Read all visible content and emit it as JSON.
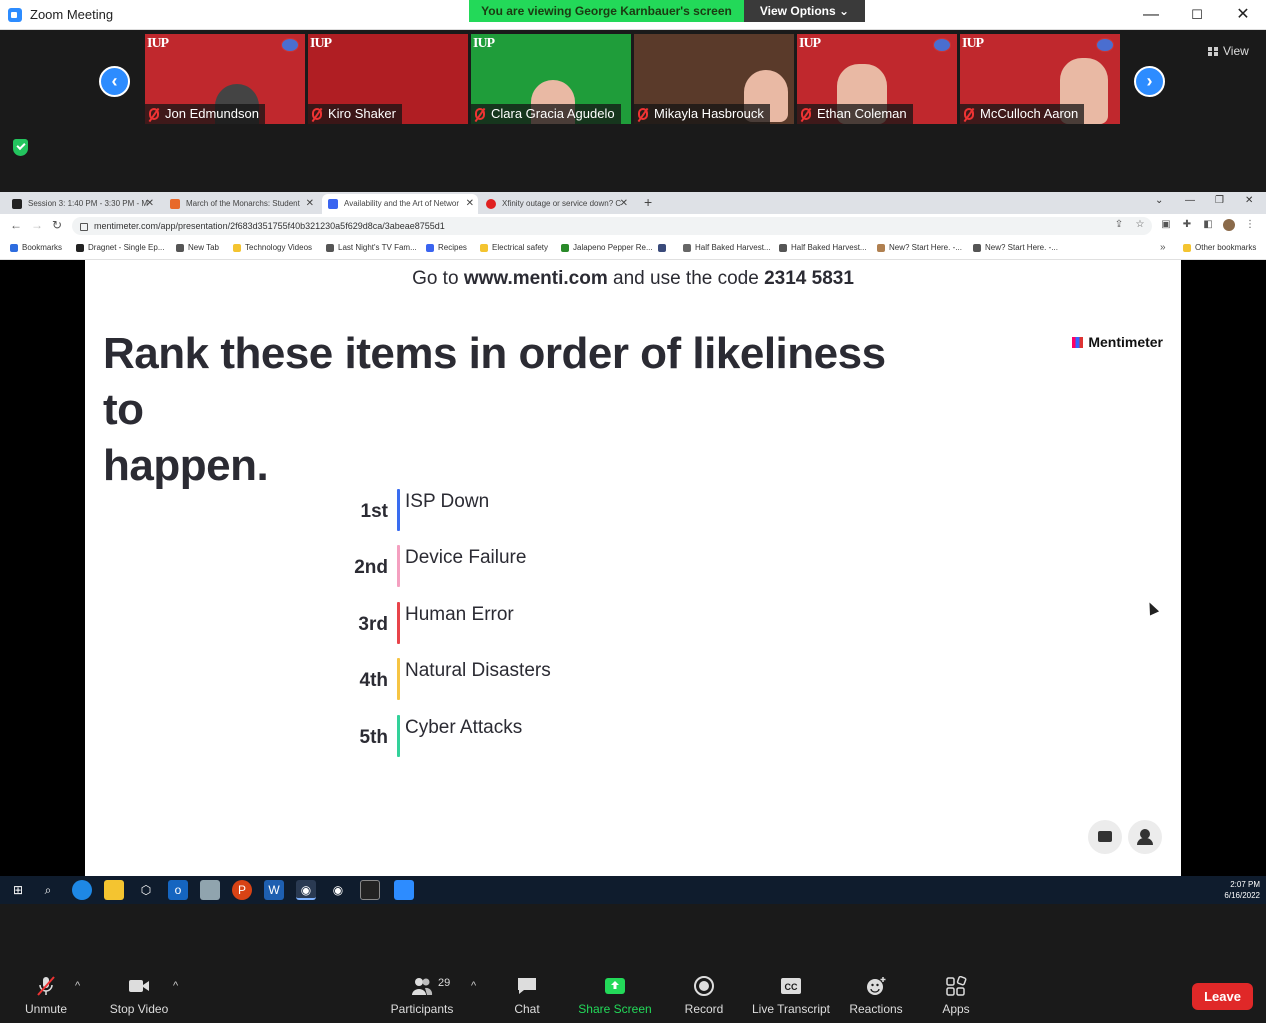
{
  "window": {
    "title": "Zoom Meeting",
    "viewing_banner": "You are viewing George Karnbauer's screen",
    "view_options_label": "View Options",
    "view_options_chevron": "⌄",
    "minimize": "—",
    "maximize": "☐",
    "close": "✕"
  },
  "gallery": {
    "prev_icon": "‹",
    "next_icon": "›",
    "view_label": "View",
    "participants": [
      {
        "name": "Jon Edmundson",
        "bg": "#c0282d"
      },
      {
        "name": "Kiro Shaker",
        "bg": "#b01e23"
      },
      {
        "name": "Clara Gracia Agudelo",
        "bg": "#1f9d3a"
      },
      {
        "name": "Mikayla Hasbrouck",
        "bg": "#5a3a2a"
      },
      {
        "name": "Ethan Coleman",
        "bg": "#c0282d"
      },
      {
        "name": "McCulloch Aaron",
        "bg": "#c0282d"
      }
    ],
    "logo_text": "IUP"
  },
  "browser": {
    "tabs": [
      {
        "title": "Session 3: 1:40 PM - 3:30 PM - M",
        "color": "#222"
      },
      {
        "title": "March of the Monarchs: Student",
        "color": "#e8692a"
      },
      {
        "title": "Availability and the Art of Networ",
        "color": "#3a64f0"
      },
      {
        "title": "Xfinity outage or service down? C",
        "color": "#e02020"
      }
    ],
    "new_tab": "+",
    "tab_controls": {
      "dropdown": "⌄",
      "min": "—",
      "max": "❐",
      "close": "✕"
    },
    "nav": {
      "back": "←",
      "forward": "→",
      "reload": "↻"
    },
    "url": "mentimeter.com/app/presentation/2f683d351755f40b321230a5f629d8ca/3abeae8755d1",
    "bookmarks": [
      {
        "label": "Bookmarks",
        "color": "#2d6cdf"
      },
      {
        "label": "Dragnet - Single Ep...",
        "color": "#222"
      },
      {
        "label": "New Tab",
        "color": "#555"
      },
      {
        "label": "Technology Videos",
        "color": "#f4c430"
      },
      {
        "label": "Last Night's TV Fam...",
        "color": "#555"
      },
      {
        "label": "Recipes",
        "color": "#3a64f0"
      },
      {
        "label": "Electrical safety",
        "color": "#f4c430"
      },
      {
        "label": "Jalapeno Pepper Re...",
        "color": "#2a8a2a"
      },
      {
        "label": "Half Baked Harvest...",
        "color": "#666"
      },
      {
        "label": "Half Baked Harvest...",
        "color": "#555"
      },
      {
        "label": "New? Start Here. -...",
        "color": "#b08050"
      },
      {
        "label": "New? Start Here. -...",
        "color": "#555"
      }
    ],
    "bookmarks_more": "»",
    "other_bookmarks": "Other bookmarks"
  },
  "slide": {
    "join_prefix": "Go to ",
    "join_site": "www.menti.com",
    "join_middle": " and use the code ",
    "join_code": "2314 5831",
    "brand": "Mentimeter",
    "question_line1": "Rank these items in order of likeliness to",
    "question_line2": "happen.",
    "ranking": [
      {
        "pos": "1st",
        "label": "ISP Down",
        "color": "#3a6df0"
      },
      {
        "pos": "2nd",
        "label": "Device Failure",
        "color": "#f4a0c0"
      },
      {
        "pos": "3rd",
        "label": "Human Error",
        "color": "#e8444a"
      },
      {
        "pos": "4th",
        "label": "Natural Disasters",
        "color": "#f6c443"
      },
      {
        "pos": "5th",
        "label": "Cyber Attacks",
        "color": "#33d19a"
      }
    ]
  },
  "taskbar": {
    "time": "2:07 PM",
    "date": "6/16/2022"
  },
  "toolbar": {
    "unmute": "Unmute",
    "stop_video": "Stop Video",
    "participants": "Participants",
    "participants_count": "29",
    "chat": "Chat",
    "share_screen": "Share Screen",
    "record": "Record",
    "live_transcript": "Live Transcript",
    "transcript_badge": "CC",
    "reactions": "Reactions",
    "apps": "Apps",
    "leave": "Leave",
    "caret": "^"
  },
  "colors": {
    "zoom_blue": "#2d8cff",
    "share_green": "#23d959",
    "leave_red": "#e02828"
  }
}
